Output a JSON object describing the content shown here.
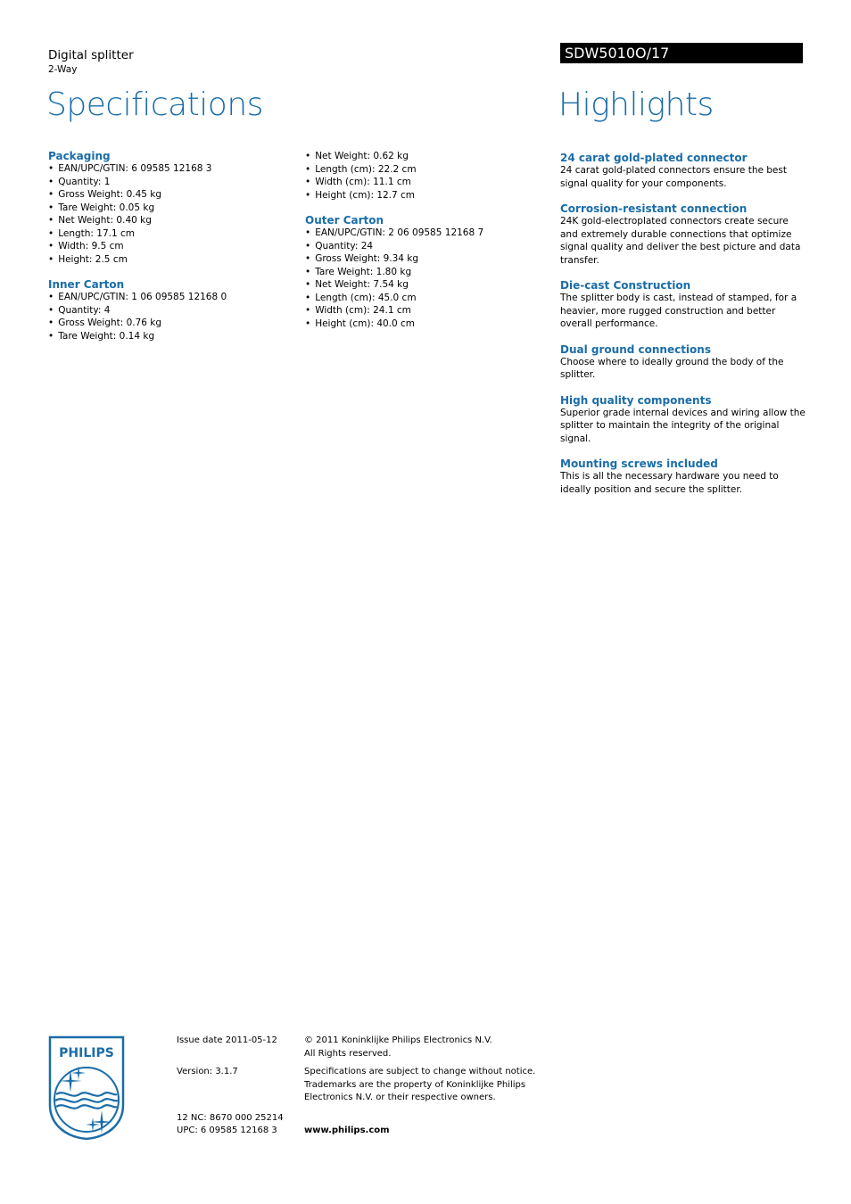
{
  "header": {
    "product_name": "Digital splitter",
    "product_variant": "2-Way",
    "model_number": "SDW5010O/17",
    "spec_title": "Specifications",
    "highlights_title": "Highlights"
  },
  "colors": {
    "accent": "#1a6da8",
    "model_bar_bg": "#000000",
    "model_bar_text": "#ffffff"
  },
  "specifications": {
    "column_1": [
      {
        "title": "Packaging",
        "items": [
          "EAN/UPC/GTIN: 6 09585 12168 3",
          "Quantity: 1",
          "Gross Weight: 0.45 kg",
          "Tare Weight: 0.05 kg",
          "Net Weight: 0.40 kg",
          "Length: 17.1 cm",
          "Width: 9.5 cm",
          "Height: 2.5 cm"
        ]
      },
      {
        "title": "Inner Carton",
        "items": [
          "EAN/UPC/GTIN: 1 06 09585 12168 0",
          "Quantity: 4",
          "Gross Weight: 0.76 kg",
          "Tare Weight: 0.14 kg"
        ]
      }
    ],
    "column_2": [
      {
        "title": "",
        "items": [
          "Net Weight: 0.62 kg",
          "Length (cm): 22.2 cm",
          "Width (cm): 11.1 cm",
          "Height (cm): 12.7 cm"
        ]
      },
      {
        "title": "Outer Carton",
        "items": [
          "EAN/UPC/GTIN: 2 06 09585 12168 7",
          "Quantity: 24",
          "Gross Weight: 9.34 kg",
          "Tare Weight: 1.80 kg",
          "Net Weight: 7.54 kg",
          "Length (cm): 45.0 cm",
          "Width (cm): 24.1 cm",
          "Height (cm): 40.0 cm"
        ]
      }
    ]
  },
  "highlights": [
    {
      "title": "24 carat gold-plated connector",
      "body": "24 carat gold-plated connectors ensure the best signal quality for your components."
    },
    {
      "title": "Corrosion-resistant connection",
      "body": "24K gold-electroplated connectors create secure and extremely durable connections that optimize signal quality and deliver the best picture and data transfer."
    },
    {
      "title": "Die-cast Construction",
      "body": "The splitter body is cast, instead of stamped, for a heavier, more rugged construction and better overall performance."
    },
    {
      "title": "Dual ground connections",
      "body": "Choose where to ideally ground the body of the splitter."
    },
    {
      "title": "High quality components",
      "body": "Superior grade internal devices and wiring allow the splitter to maintain the integrity of the original signal."
    },
    {
      "title": "Mounting screws included",
      "body": "This is all the necessary hardware you need to ideally position and secure the splitter."
    }
  ],
  "footer": {
    "logo_text": "PHILIPS",
    "issue_date": "Issue date 2011-05-12",
    "version": "Version: 3.1.7",
    "nc": "12 NC: 8670 000 25214",
    "upc": "UPC: 6 09585 12168 3",
    "copyright_line1": "© 2011 Koninklijke Philips Electronics N.V.",
    "copyright_line2": "All Rights reserved.",
    "disclaimer_line1": "Specifications are subject to change without notice.",
    "disclaimer_line2": "Trademarks are the property of Koninklijke Philips",
    "disclaimer_line3": "Electronics N.V. or their respective owners.",
    "website": "www.philips.com"
  }
}
